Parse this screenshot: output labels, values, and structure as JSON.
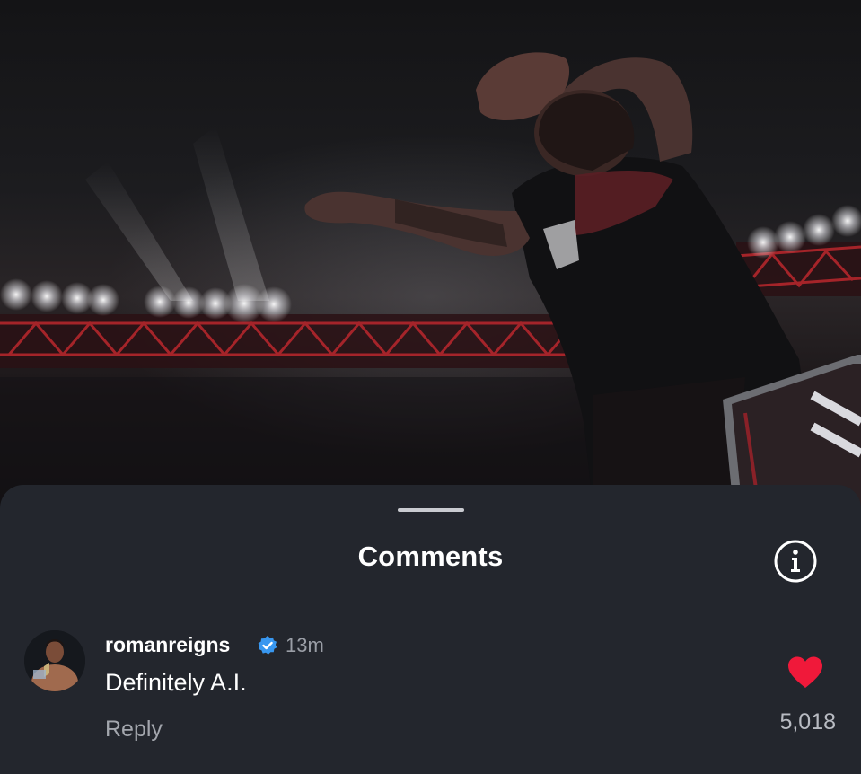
{
  "sheet": {
    "title": "Comments",
    "info_icon": "info-circle-icon"
  },
  "comment": {
    "username": "romanreigns",
    "verified_icon": "verified-badge-icon",
    "time": "13m",
    "text": "Definitely A.I.",
    "reply_label": "Reply",
    "like_icon": "heart-icon",
    "like_count": "5,018"
  },
  "colors": {
    "sheet_background": "#23262d",
    "heart": "#f0193a",
    "verified": "#3897f0"
  }
}
